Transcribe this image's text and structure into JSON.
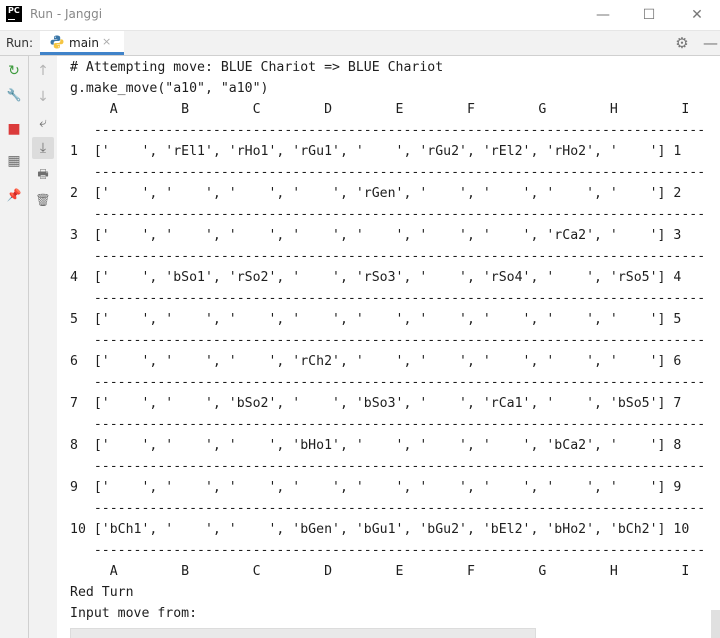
{
  "window": {
    "title": "Run - Janggi",
    "app_icon_text": "PC",
    "minimize_glyph": "—",
    "maximize_glyph": "☐",
    "close_glyph": "✕"
  },
  "run_panel": {
    "label": "Run:",
    "tab_label": "main",
    "tab_close_glyph": "×",
    "settings_glyph": "⚙",
    "hide_glyph": "—"
  },
  "toolbar": [
    {
      "name": "rerun-icon",
      "glyph": "↻",
      "color": "#3c9a3c"
    },
    {
      "name": "wrench-icon",
      "glyph": "🔧",
      "color": "#6f6f6f"
    },
    {
      "name": "stop-icon",
      "glyph": "■",
      "color": "#db3b3b"
    },
    {
      "name": "layout-icon",
      "glyph": "▦",
      "color": "#6f6f6f"
    },
    {
      "name": "pin-icon",
      "glyph": "📌",
      "color": "#6f6f6f"
    }
  ],
  "toolbar2": [
    {
      "name": "up-arrow-icon",
      "glyph": "↑",
      "color": "#b5b5b5"
    },
    {
      "name": "down-arrow-icon",
      "glyph": "↓",
      "color": "#b5b5b5"
    },
    {
      "name": "soft-wrap-icon",
      "glyph": "⤶",
      "color": "#6f6f6f"
    },
    {
      "name": "scroll-to-end-icon",
      "glyph": "⤓",
      "color": "#6f6f6f"
    },
    {
      "name": "print-icon",
      "glyph": "🖶",
      "color": "#6f6f6f"
    },
    {
      "name": "trash-icon",
      "glyph": "🗑",
      "color": "#6f6f6f"
    }
  ],
  "console": {
    "lines": [
      "# Attempting move: BLUE Chariot => BLUE Chariot",
      "g.make_move(\"a10\", \"a10\")",
      "     A        B        C        D        E        F        G        H        I",
      "   -----------------------------------------------------------------------------",
      "1  ['    ', 'rEl1', 'rHo1', 'rGu1', '    ', 'rGu2', 'rEl2', 'rHo2', '    '] 1",
      "   -----------------------------------------------------------------------------",
      "2  ['    ', '    ', '    ', '    ', 'rGen', '    ', '    ', '    ', '    '] 2",
      "   -----------------------------------------------------------------------------",
      "3  ['    ', '    ', '    ', '    ', '    ', '    ', '    ', 'rCa2', '    '] 3",
      "   -----------------------------------------------------------------------------",
      "4  ['    ', 'bSo1', 'rSo2', '    ', 'rSo3', '    ', 'rSo4', '    ', 'rSo5'] 4",
      "   -----------------------------------------------------------------------------",
      "5  ['    ', '    ', '    ', '    ', '    ', '    ', '    ', '    ', '    '] 5",
      "   -----------------------------------------------------------------------------",
      "6  ['    ', '    ', '    ', 'rCh2', '    ', '    ', '    ', '    ', '    '] 6",
      "   -----------------------------------------------------------------------------",
      "7  ['    ', '    ', 'bSo2', '    ', 'bSo3', '    ', 'rCa1', '    ', 'bSo5'] 7",
      "   -----------------------------------------------------------------------------",
      "8  ['    ', '    ', '    ', 'bHo1', '    ', '    ', '    ', 'bCa2', '    '] 8",
      "   -----------------------------------------------------------------------------",
      "9  ['    ', '    ', '    ', '    ', '    ', '    ', '    ', '    ', '    '] 9",
      "   -----------------------------------------------------------------------------",
      "10 ['bCh1', '    ', '    ', 'bGen', 'bGu1', 'bGu2', 'bEl2', 'bHo2', 'bCh2'] 10",
      "   -----------------------------------------------------------------------------",
      "     A        B        C        D        E        F        G        H        I",
      "Red Turn",
      "Input move from:"
    ]
  }
}
